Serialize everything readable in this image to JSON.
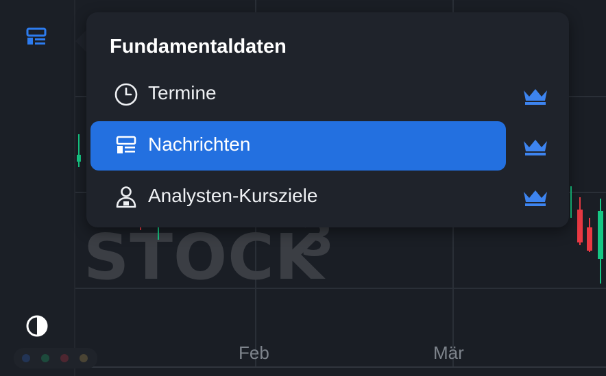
{
  "popup": {
    "title": "Fundamentaldaten",
    "items": [
      {
        "label": "Termine",
        "icon": "clock-icon",
        "premium_icon": "crown-icon",
        "active": false
      },
      {
        "label": "Nachrichten",
        "icon": "news-icon",
        "premium_icon": "crown-icon",
        "active": true
      },
      {
        "label": "Analysten-Kursziele",
        "icon": "analyst-icon",
        "premium_icon": "crown-icon",
        "active": false
      }
    ]
  },
  "chart": {
    "watermark": "STOCK",
    "watermark_sup": "3",
    "x_axis_labels": [
      "Feb",
      "Mär"
    ]
  },
  "sidebar": {
    "icons": [
      "news-icon",
      "contrast-icon"
    ]
  },
  "colors": {
    "accent": "#2370e0",
    "crown": "#3d84f0",
    "candle_up": "#16c784",
    "candle_down": "#ea3943",
    "popup_bg": "#1f232b",
    "background": "#1b1f26"
  }
}
